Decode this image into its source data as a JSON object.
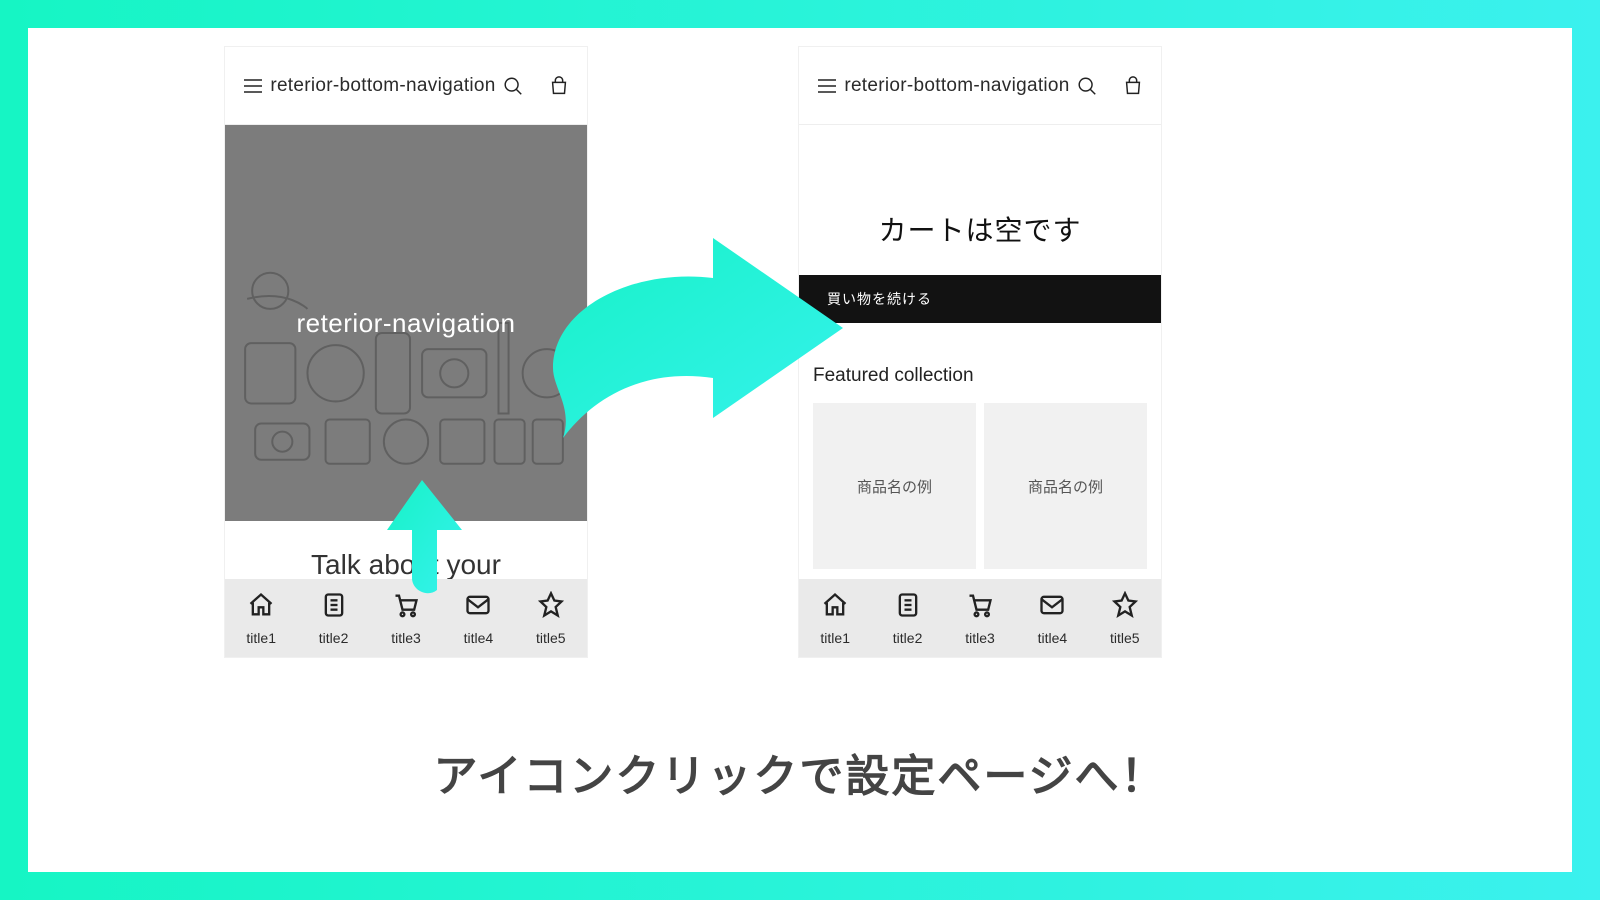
{
  "header": {
    "title": "reterior-bottom-navigation"
  },
  "hero": {
    "text": "reterior-navigation"
  },
  "below_hero": "Talk about your",
  "cart": {
    "empty": "カートは空です",
    "continue": "買い物を続ける",
    "featured": "Featured collection",
    "product_name": "商品名の例"
  },
  "bottomnav": [
    {
      "label": "title1",
      "icon": "home"
    },
    {
      "label": "title2",
      "icon": "list"
    },
    {
      "label": "title3",
      "icon": "cart"
    },
    {
      "label": "title4",
      "icon": "mail"
    },
    {
      "label": "title5",
      "icon": "star"
    }
  ],
  "caption": "アイコンクリックで設定ページへ！"
}
